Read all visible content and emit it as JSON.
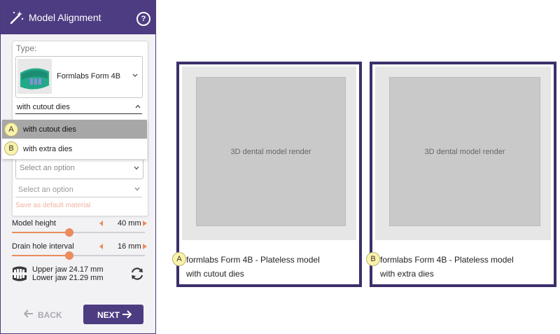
{
  "panel": {
    "title": "Model Alignment",
    "help": "?",
    "type_label": "Type:",
    "printer": "Formlabs Form 4B",
    "variant_value": "with cutout dies",
    "dropdown_options": [
      {
        "badge": "A",
        "label": "with cutout dies"
      },
      {
        "badge": "B",
        "label": "with extra dies"
      }
    ],
    "select1_placeholder": "Select an option",
    "select2_placeholder": "Select an option",
    "save_default": "Save as default material",
    "model_height": {
      "label": "Model height",
      "value": "40 mm",
      "fraction": 0.43
    },
    "drain_hole": {
      "label": "Drain hole interval",
      "value": "16 mm",
      "fraction": 0.43
    },
    "upper_jaw": "Upper jaw 24.17 mm",
    "lower_jaw": "Lower jaw 21.29 mm",
    "back": "BACK",
    "next": "NEXT"
  },
  "figures": [
    {
      "badge": "A",
      "line1": "formlabs Form 4B - Plateless model",
      "line2": "with cutout dies"
    },
    {
      "badge": "B",
      "line1": "formlabs Form 4B - Plateless model",
      "line2": "with extra dies"
    }
  ],
  "colors": {
    "accent": "#4d3c82",
    "slider": "#ea8c5c",
    "badge": "#fbf3a9"
  }
}
